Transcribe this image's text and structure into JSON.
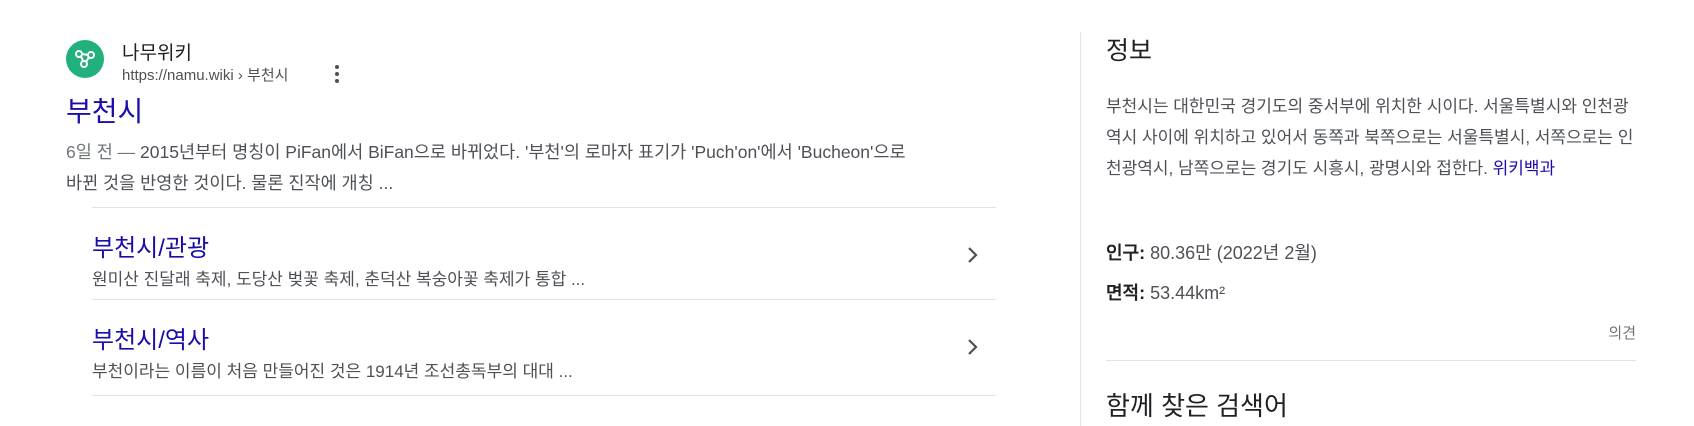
{
  "result": {
    "site_name": "나무위키",
    "site_url": "https://namu.wiki › 부천시",
    "title": "부천시",
    "snippet_date": "6일 전 —",
    "snippet_text": "2015년부터 명칭이 PiFan에서 BiFan으로 바뀌었다. '부천'의 로마자 표기가 'Puch'on'에서 'Bucheon'으로 바뀐 것을 반영한 것이다. 물론 진작에 개칭 ...",
    "sublinks": [
      {
        "title": "부천시/관광",
        "desc": "원미산 진달래 축제, 도당산 벚꽃 축제, 춘덕산 복숭아꽃 축제가 통합 ..."
      },
      {
        "title": "부천시/역사",
        "desc": "부천이라는 이름이 처음 만들어진 것은 1914년 조선총독부의 대대 ..."
      }
    ]
  },
  "panel": {
    "heading": "정보",
    "description": "부천시는 대한민국 경기도의 중서부에 위치한 시이다. 서울특별시와 인천광역시 사이에 위치하고 있어서 동쪽과 북쪽으로는 서울특별시, 서쪽으로는 인천광역시, 남쪽으로는 경기도 시흥시, 광명시와 접한다.",
    "source_link": "위키백과",
    "facts": [
      {
        "label": "인구:",
        "value": "80.36만 (2022년 2월)"
      },
      {
        "label": "면적:",
        "value": "53.44km²"
      }
    ],
    "feedback": "의견",
    "related_heading": "함께 찾은 검색어"
  },
  "colors": {
    "link": "#1a0dab",
    "favicon": "#22b07d",
    "text": "#4d5156"
  },
  "icons": [
    "namu-wiki-favicon-icon",
    "more-vert-icon",
    "chevron-right-icon"
  ]
}
